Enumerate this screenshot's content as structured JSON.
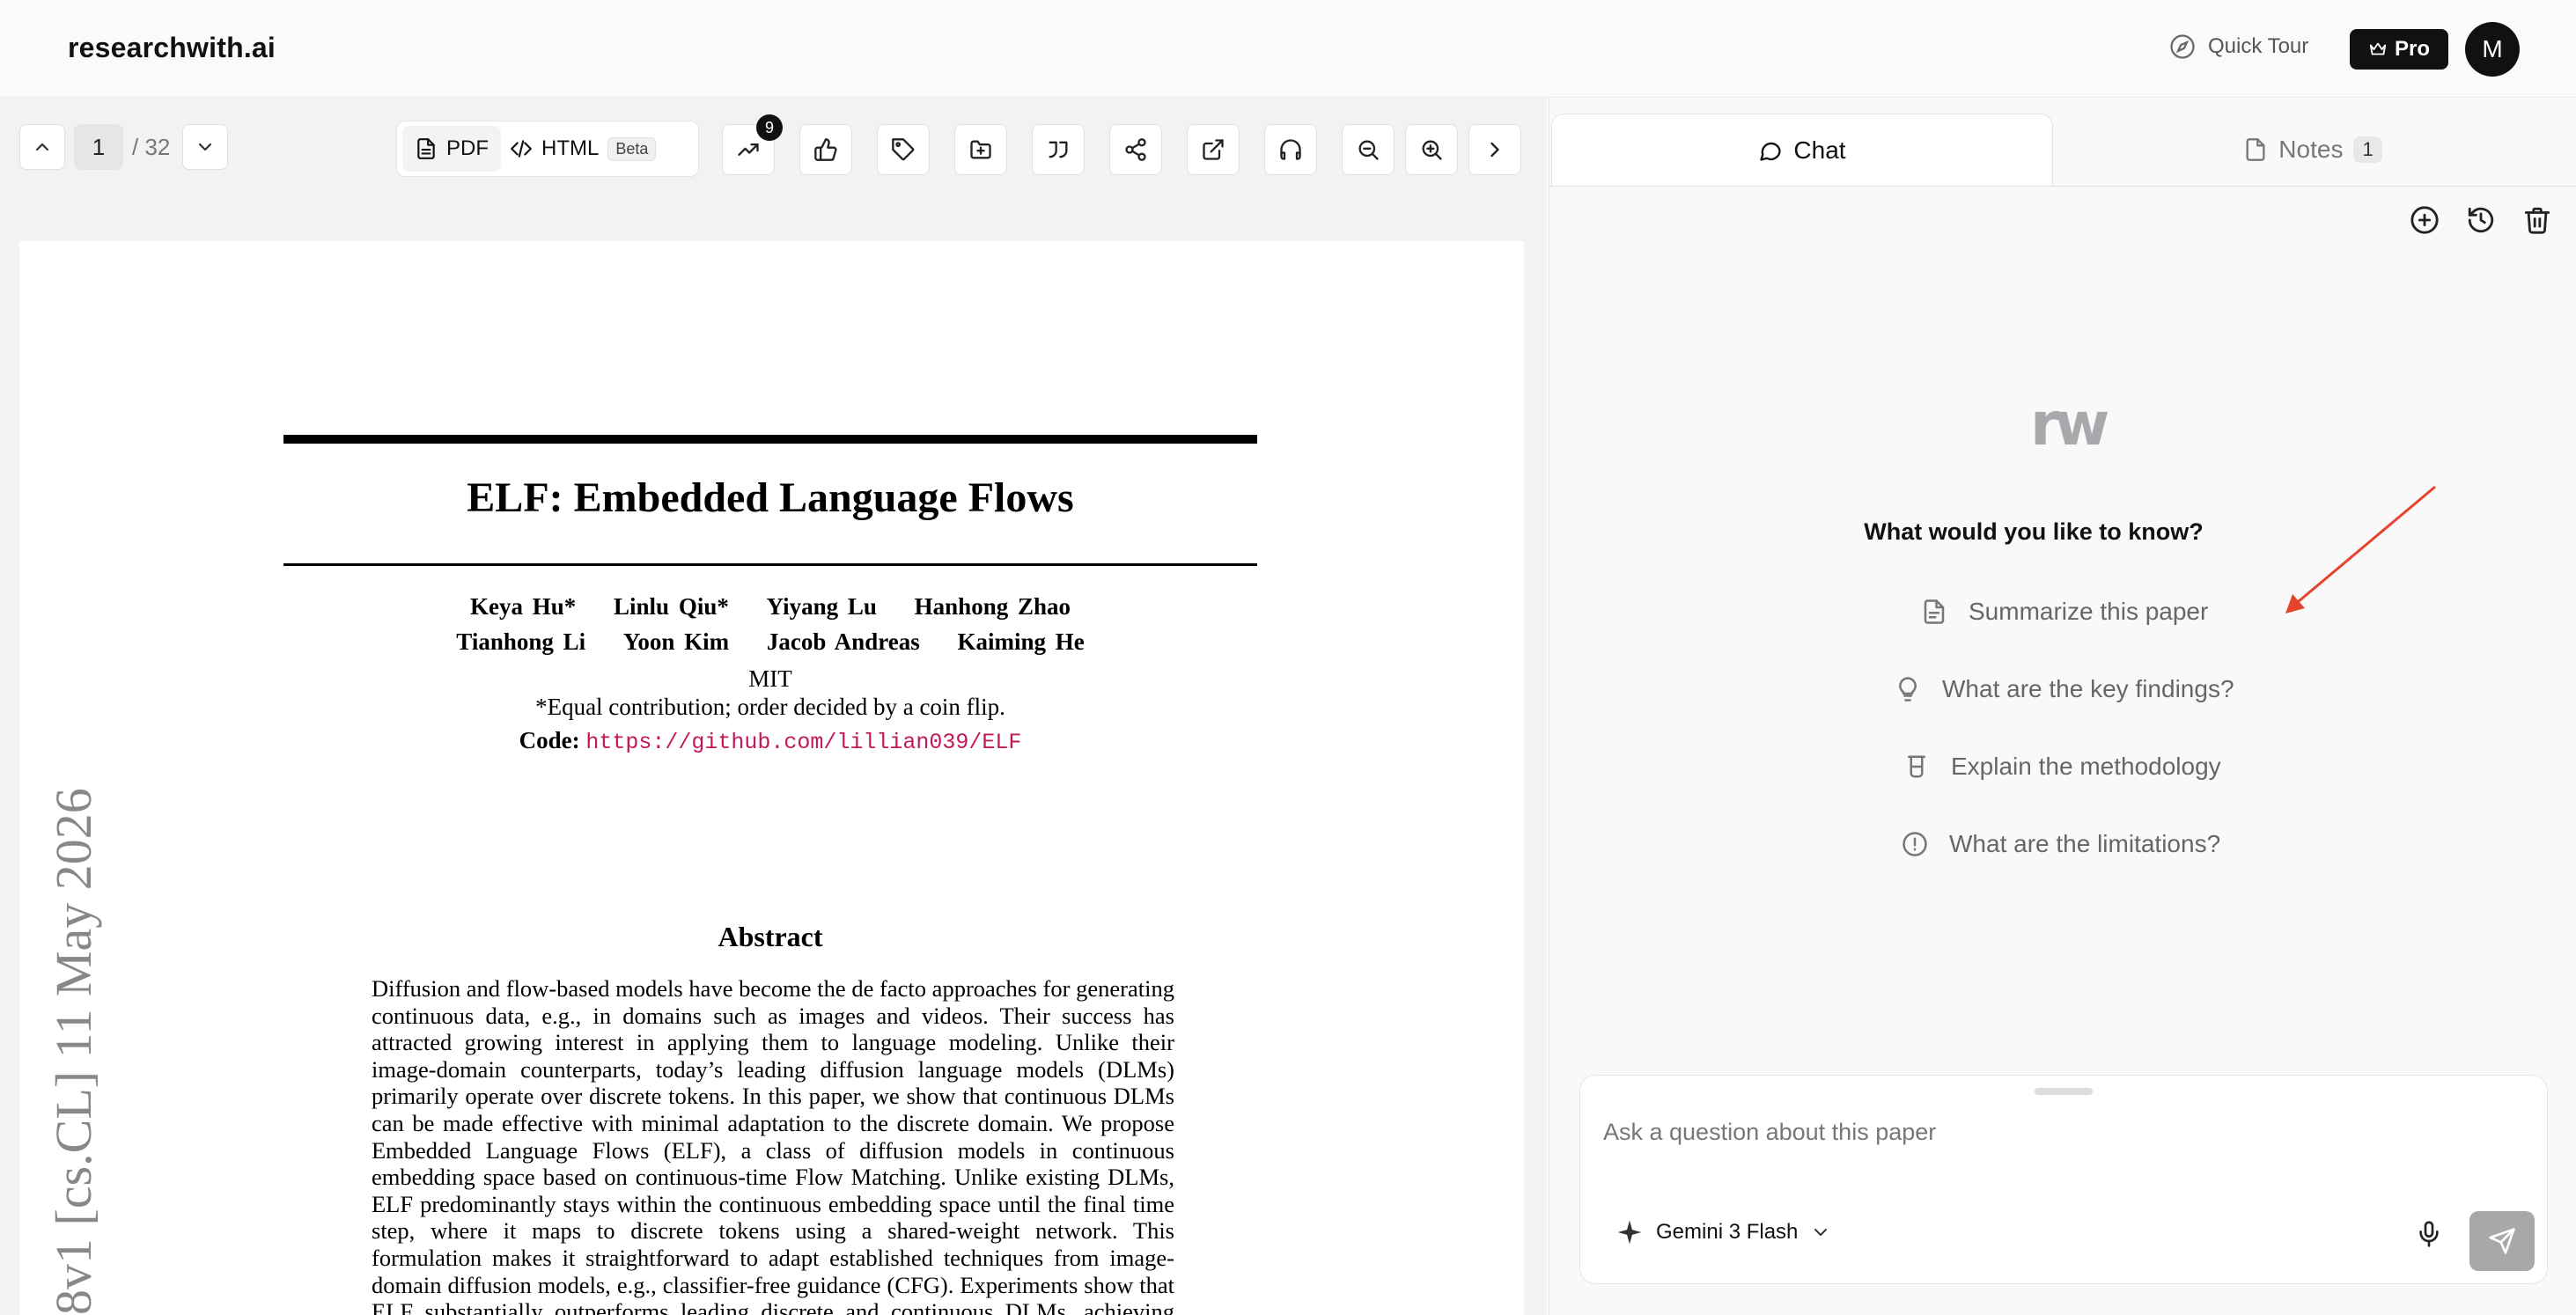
{
  "app": {
    "brand": "researchwith.ai",
    "quick_tour_label": "Quick Tour",
    "pro_label": "Pro",
    "avatar_initial": "M"
  },
  "viewer": {
    "current_page": "1",
    "total_pages": "/ 32",
    "pdf_label": "PDF",
    "html_label": "HTML",
    "beta_label": "Beta",
    "trending_badge": "9",
    "toolbar_icons": [
      "trending-icon",
      "thumbs-up-icon",
      "tag-icon",
      "folder-plus-icon",
      "quote-icon",
      "share-icon",
      "external-link-icon",
      "headphones-icon",
      "zoom-out-icon",
      "zoom-in-icon",
      "chevron-right-icon"
    ]
  },
  "paper": {
    "title": "ELF: Embedded Language Flows",
    "authors_line1": [
      "Keya Hu*",
      "Linlu Qiu*",
      "Yiyang Lu",
      "Hanhong Zhao"
    ],
    "authors_line2": [
      "Tianhong Li",
      "Yoon Kim",
      "Jacob Andreas",
      "Kaiming He"
    ],
    "affiliation": "MIT",
    "equal_note": "*Equal contribution; order decided by a coin flip.",
    "code_label": "Code:",
    "code_url": "https://github.com/lillian039/ELF",
    "abstract_heading": "Abstract",
    "abstract_text": "Diffusion and flow-based models have become the de facto approaches for generating continuous data, e.g., in domains such as images and videos. Their success has attracted growing interest in applying them to language modeling. Unlike their image-domain counterparts, today’s leading diffusion language models (DLMs) primarily operate over discrete tokens. In this paper, we show that continuous DLMs can be made effective with minimal adaptation to the discrete domain. We propose Embedded Language Flows (ELF), a class of diffusion models in continuous embedding space based on continuous-time Flow Matching. Unlike existing DLMs, ELF predominantly stays within the continuous embedding space until the final time step, where it maps to discrete tokens using a shared-weight network. This formulation makes it straightforward to adapt established techniques from image-domain diffusion models, e.g., classifier-free guidance (CFG). Experiments show that ELF substantially outperforms leading discrete and continuous DLMs, achieving better generation quality with fewer sampling steps. These results suggest that ELF offers a promising path toward effective continuous DLMs.",
    "arxiv_stamp": "8v1  [cs.CL]  11 May 2026"
  },
  "chat": {
    "tab_chat": "Chat",
    "tab_notes": "Notes",
    "notes_count": "1",
    "logo_text": "rw",
    "prompt_title": "What would you like to know?",
    "suggestions": [
      {
        "label": "Summarize this paper",
        "icon": "document-icon"
      },
      {
        "label": "What are the key findings?",
        "icon": "lightbulb-icon"
      },
      {
        "label": "Explain the methodology",
        "icon": "beaker-icon"
      },
      {
        "label": "What are the limitations?",
        "icon": "alert-circle-icon"
      }
    ],
    "input_placeholder": "Ask a question about this paper",
    "model_name": "Gemini 3 Flash",
    "accent_arrow_color": "#e5432e"
  }
}
